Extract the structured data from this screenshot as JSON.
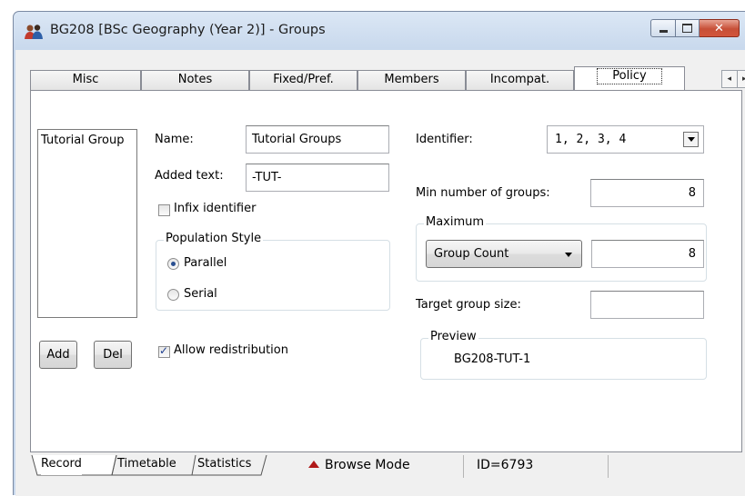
{
  "window": {
    "title": "BG208 [BSc Geography (Year 2)] - Groups",
    "icon": "people-icon",
    "buttons": {
      "minimize_icon": "minimize-icon",
      "maximize_icon": "maximize-icon",
      "close_icon": "close-icon"
    }
  },
  "tabs": [
    {
      "label": "Misc"
    },
    {
      "label": "Notes"
    },
    {
      "label": "Fixed/Pref."
    },
    {
      "label": "Members"
    },
    {
      "label": "Incompat."
    },
    {
      "label": "Policy",
      "active": true
    }
  ],
  "tab_scroll": {
    "left": "◂",
    "right": "▸"
  },
  "group_list": {
    "items": [
      "Tutorial Group"
    ],
    "add_label": "Add",
    "del_label": "Del"
  },
  "form": {
    "name_label": "Name:",
    "name_value": "Tutorial Groups",
    "added_text_label": "Added text:",
    "added_text_value": "-TUT-",
    "infix_label": "Infix identifier",
    "infix_checked": false,
    "population_style": {
      "legend": "Population Style",
      "parallel_label": "Parallel",
      "serial_label": "Serial",
      "selected": "Parallel"
    },
    "allow_redistribution_label": "Allow redistribution",
    "allow_redistribution_checked": true,
    "identifier_label": "Identifier:",
    "identifier_value": "1, 2, 3, 4",
    "min_groups_label": "Min number of groups:",
    "min_groups_value": "8",
    "maximum": {
      "legend": "Maximum",
      "mode_value": "Group Count",
      "count_value": "8"
    },
    "target_size_label": "Target group size:",
    "target_size_value": "",
    "preview": {
      "legend": "Preview",
      "value": "BG208-TUT-1"
    }
  },
  "statusbar": {
    "sheet_tabs": [
      "Record",
      "Timetable",
      "Statistics"
    ],
    "mode_label": "Browse Mode",
    "id_label": "ID=6793"
  },
  "colors": {
    "title_gradient_top": "#dbe7f5",
    "close_button": "#c74f37",
    "mode_arrow": "#b01818"
  }
}
